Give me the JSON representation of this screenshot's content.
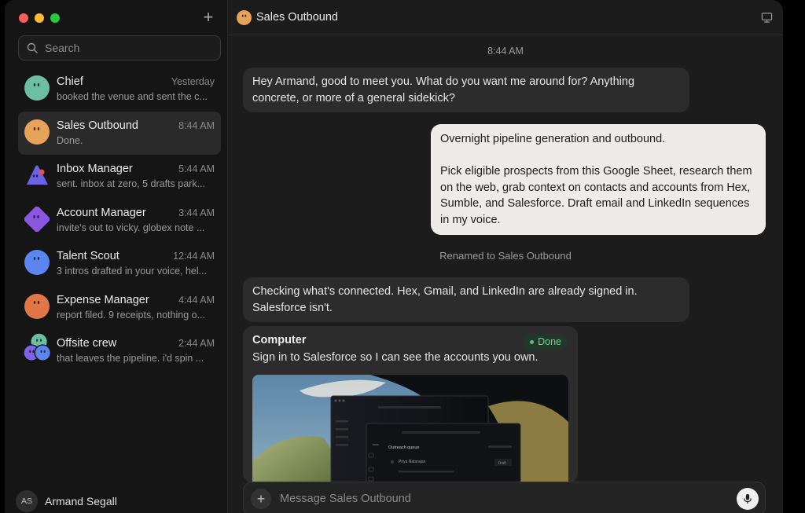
{
  "sidebar": {
    "new_chat_icon": "plus-icon",
    "search_placeholder": "Search",
    "conversations": [
      {
        "name": "Chief",
        "time": "Yesterday",
        "preview": "booked the venue and sent the c...",
        "avatar_color": "#6cbfa3"
      },
      {
        "name": "Sales Outbound",
        "time": "8:44 AM",
        "preview": "Done.",
        "avatar_color": "#e9a25a"
      },
      {
        "name": "Inbox Manager",
        "time": "5:44 AM",
        "preview": "sent. inbox at zero, 5 drafts park...",
        "avatar_color": "#6b63e6"
      },
      {
        "name": "Account Manager",
        "time": "3:44 AM",
        "preview": "invite's out to vicky. globex note ...",
        "avatar_color": "#8a58e0"
      },
      {
        "name": "Talent Scout",
        "time": "12:44 AM",
        "preview": "3 intros drafted in your voice, hel...",
        "avatar_color": "#5b86f0"
      },
      {
        "name": "Expense Manager",
        "time": "4:44 AM",
        "preview": "report filed. 9 receipts, nothing o...",
        "avatar_color": "#e07746"
      },
      {
        "name": "Offsite crew",
        "time": "2:44 AM",
        "preview": "that leaves the pipeline. i'd spin ...",
        "avatar_color": "#7e62e8"
      }
    ],
    "user": {
      "initials": "AS",
      "name": "Armand Segall"
    }
  },
  "main": {
    "title": "Sales Outbound",
    "timestamp": "8:44 AM",
    "messages": {
      "ai_1": "Hey Armand, good to meet you. What do you want me around for? Anything concrete, or more of a general sidekick?",
      "user_1_line1": "Overnight pipeline generation and outbound.",
      "user_1_line2": "Pick eligible prospects from this Google Sheet, research them on the web, grab context on contacts and accounts from Hex, Sumble, and Salesforce. Draft email and LinkedIn sequences in my voice.",
      "system_note": "Renamed to Sales Outbound",
      "ai_2": "Checking what's connected. Hex, Gmail, and LinkedIn are already signed in. Salesforce isn't."
    },
    "card": {
      "title": "Computer",
      "status": "Done",
      "text": "Sign in to Salesforce so I can see the accounts you own.",
      "screenshot": {
        "panel_title": "Outreach queue",
        "row_name": "Priya Natarajan",
        "row_status": "Draft"
      }
    },
    "composer_placeholder": "Message Sales Outbound"
  },
  "colors": {
    "accent_done": "#6fcf8e",
    "user_bubble": "#eeece8",
    "ai_bubble": "#2c2c2c"
  }
}
